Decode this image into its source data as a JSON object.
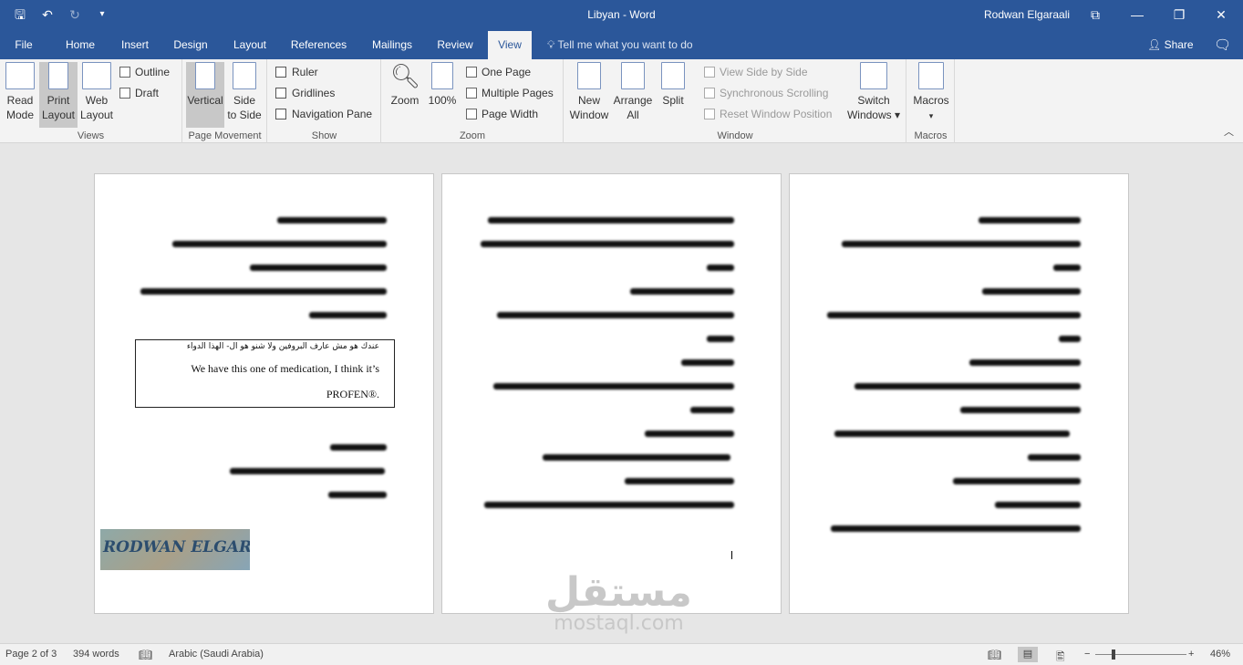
{
  "window": {
    "title": "Libyan  -  Word",
    "user": "Rodwan Elgaraali",
    "qat": {
      "save_icon": "save-icon",
      "undo_icon": "undo-icon",
      "redo_icon": "redo-icon",
      "customize_icon": "customize-icon"
    },
    "controls": {
      "ribbon_display": "⧉",
      "minimize": "—",
      "restore": "❐",
      "close": "✕"
    }
  },
  "tabs": [
    {
      "label": "File"
    },
    {
      "label": "Home"
    },
    {
      "label": "Insert"
    },
    {
      "label": "Design"
    },
    {
      "label": "Layout"
    },
    {
      "label": "References"
    },
    {
      "label": "Mailings"
    },
    {
      "label": "Review"
    },
    {
      "label": "View"
    }
  ],
  "tell_me": "Tell me what you want to do",
  "share": "Share",
  "ribbon": {
    "views": {
      "label": "Views",
      "read_mode": "Read Mode",
      "read_mode_l1": "Read",
      "read_mode_l2": "Mode",
      "print_layout_l1": "Print",
      "print_layout_l2": "Layout",
      "web_layout_l1": "Web",
      "web_layout_l2": "Layout",
      "outline": "Outline",
      "draft": "Draft"
    },
    "page_movement": {
      "label": "Page Movement",
      "vertical": "Vertical",
      "side_l1": "Side",
      "side_l2": "to Side"
    },
    "show": {
      "label": "Show",
      "ruler": "Ruler",
      "gridlines": "Gridlines",
      "nav_pane": "Navigation Pane"
    },
    "zoom": {
      "label": "Zoom",
      "zoom": "Zoom",
      "hundred": "100%",
      "one_page": "One Page",
      "multiple_pages": "Multiple Pages",
      "page_width": "Page Width"
    },
    "window": {
      "label": "Window",
      "new_l1": "New",
      "new_l2": "Window",
      "arrange_l1": "Arrange",
      "arrange_l2": "All",
      "split": "Split",
      "view_side": "View Side by Side",
      "sync_scroll": "Synchronous Scrolling",
      "reset_pos": "Reset Window Position",
      "switch_l1": "Switch",
      "switch_l2": "Windows ▾"
    },
    "macros": {
      "label": "Macros",
      "macros": "Macros",
      "arrow": "▾"
    }
  },
  "document": {
    "textbox_arabic": "عندك هو مش عارف البروفين ولا شنو هو ال- الهذا الدواء",
    "textbox_en1": "We have this one of medication, I think it’s",
    "textbox_en2": "PROFEN®.",
    "watermark": "RODWAN ELGARAALI",
    "overlay_big": "مستقل",
    "overlay_small": "mostaql.com"
  },
  "status": {
    "page": "Page 2 of 3",
    "words": "394 words",
    "language": "Arabic (Saudi Arabia)",
    "zoom": "46%",
    "zoom_value": 46
  }
}
